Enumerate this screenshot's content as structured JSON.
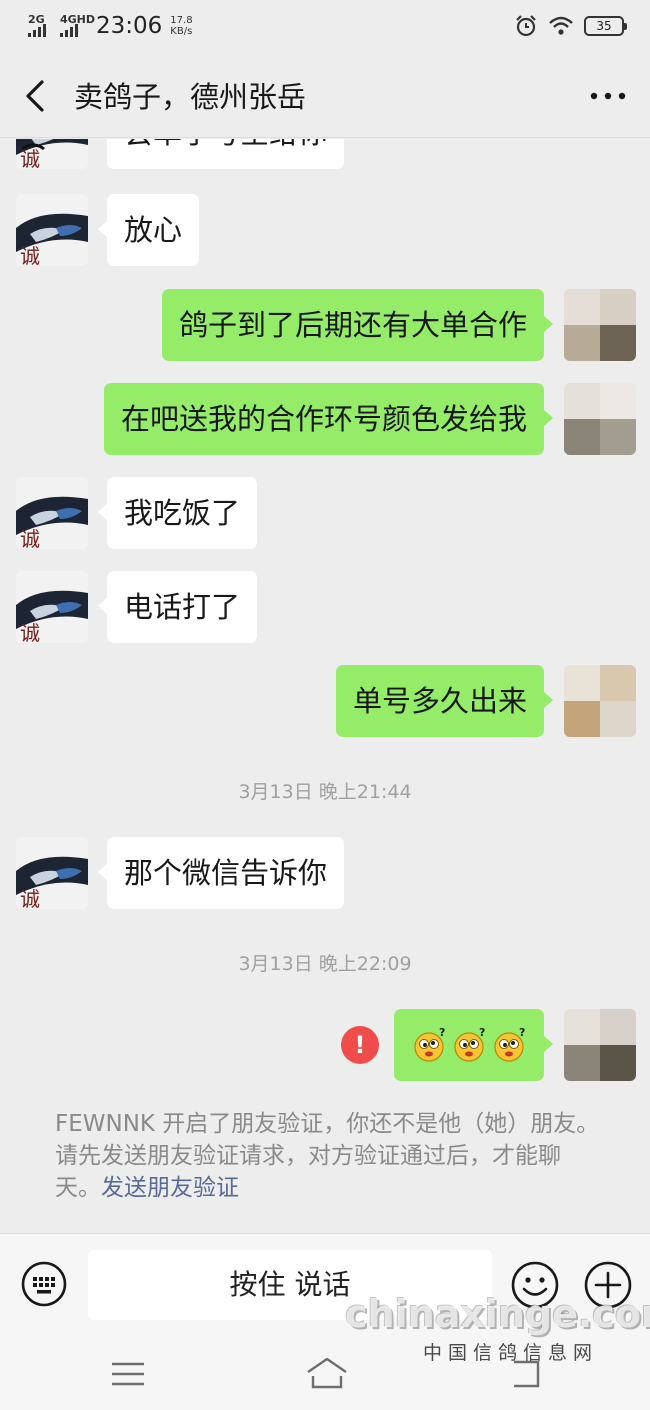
{
  "status_bar": {
    "net1": "2G",
    "net2": "4GHD",
    "time": "23:06",
    "speed_value": "17.8",
    "speed_unit": "KB/s",
    "battery": "35"
  },
  "nav": {
    "title": "卖鸽子，德州张岳",
    "back_icon": "chevron-left-icon",
    "more_icon": "more-dots-icon"
  },
  "messages": [
    {
      "from": "them",
      "text": "会单子号全给你"
    },
    {
      "from": "them",
      "text": "放心"
    },
    {
      "from": "me",
      "text": "鸽子到了后期还有大单合作"
    },
    {
      "from": "me",
      "text": "在吧送我的合作环号颜色发给我"
    },
    {
      "from": "them",
      "text": "我吃饭了"
    },
    {
      "from": "them",
      "text": "电话打了"
    },
    {
      "from": "me",
      "text": "单号多久出来"
    },
    {
      "type": "timestamp",
      "text": "3月13日 晚上21:44"
    },
    {
      "from": "them",
      "text": "那个微信告诉你"
    },
    {
      "type": "timestamp",
      "text": "3月13日 晚上22:09"
    },
    {
      "from": "me",
      "type": "emoji",
      "emoji": [
        "dizzy-face-emoji",
        "dizzy-face-emoji",
        "dizzy-face-emoji"
      ],
      "status": "send-failed"
    }
  ],
  "avatar_them_char": "诚",
  "system_notice": {
    "text": "FEWNNK 开启了朋友验证，你还不是他（她）朋友。请先发送朋友验证请求，对方验证通过后，才能聊天。",
    "link": "发送朋友验证"
  },
  "input_bar": {
    "hold_to_talk": "按住 说话",
    "keyboard_icon": "keyboard-icon",
    "emoji_icon": "smiley-icon",
    "plus_icon": "plus-icon"
  },
  "watermark": {
    "main": "chinaxinge.com",
    "sub": "中国信鸽信息网"
  },
  "colors": {
    "background": "#ededed",
    "bubble_out": "#95ec69",
    "bubble_in": "#ffffff",
    "link": "#576b95",
    "error": "#f04c4c"
  }
}
